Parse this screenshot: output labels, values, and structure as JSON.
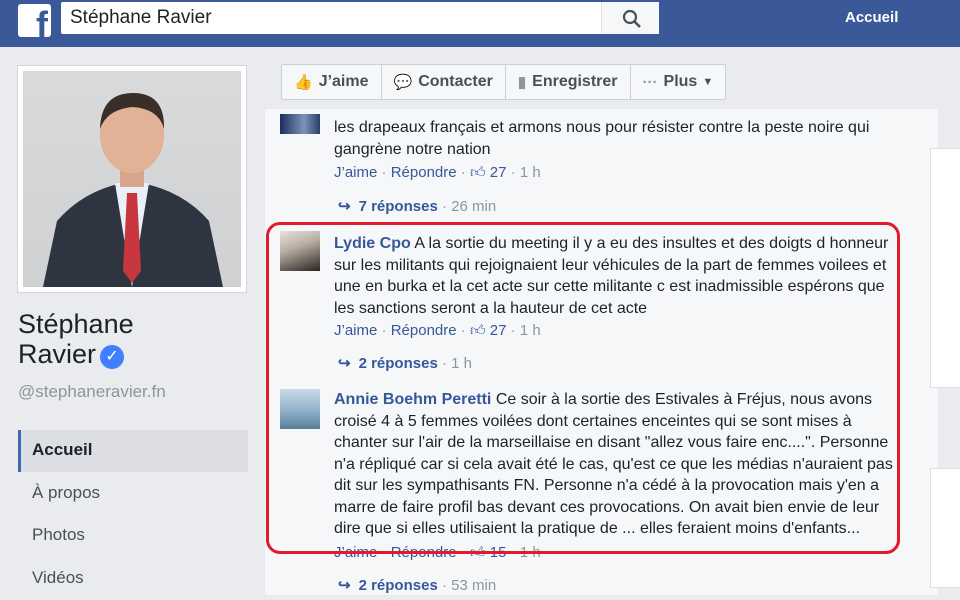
{
  "topbar": {
    "search_value": "Stéphane Ravier",
    "nav_home": "Accueil"
  },
  "profile": {
    "name_line1": "Stéphane",
    "name_line2": "Ravier",
    "handle": "@stephaneravier.fn",
    "verified_icon": "verified-check-icon"
  },
  "sidebar": {
    "items": [
      {
        "label": "Accueil",
        "active": true
      },
      {
        "label": "À propos"
      },
      {
        "label": "Photos"
      },
      {
        "label": "Vidéos"
      }
    ]
  },
  "actions": {
    "like": "J’aime",
    "contact": "Contacter",
    "save": "Enregistrer",
    "more": "Plus"
  },
  "comments": [
    {
      "author": "",
      "text": "les drapeaux français et armons nous pour résister contre la peste noire qui gangrène notre nation",
      "like": "J’aime",
      "reply": "Répondre",
      "likes": "27",
      "time": "1 h",
      "replies": "7 réponses",
      "replies_time": "26 min"
    },
    {
      "author": "Lydie Cpo",
      "text": "A la sortie du meeting il y a eu des insultes et des doigts d honneur sur les militants qui rejoignaient leur véhicules de la part de femmes voilees et une en burka et la cet acte sur cette militante c est inadmissible espérons que les sanctions seront a la hauteur de cet acte",
      "like": "J’aime",
      "reply": "Répondre",
      "likes": "27",
      "time": "1 h",
      "replies": "2 réponses",
      "replies_time": "1 h"
    },
    {
      "author": "Annie Boehm Peretti",
      "text": "Ce soir à la sortie des Estivales à Fréjus, nous avons croisé 4 à 5 femmes voilées dont certaines enceintes qui se sont mises à chanter sur l'air de la marseillaise en disant \"allez vous faire enc....\". Personne n'a répliqué car si cela avait été le cas, qu'est ce que les médias n'auraient pas dit sur les sympathisants FN. Personne n'a cédé à la provocation mais y'en a marre de faire profil bas devant ces provocations. On avait bien envie de leur dire que si elles utilisaient la pratique de ... elles feraient moins d'enfants...",
      "like": "J’aime",
      "reply": "Répondre",
      "likes": "15",
      "time": "1 h",
      "replies": "2 réponses",
      "replies_time": "53 min"
    }
  ],
  "colors": {
    "brand": "#3b5998",
    "link": "#365899",
    "highlight": "#e3192c"
  }
}
